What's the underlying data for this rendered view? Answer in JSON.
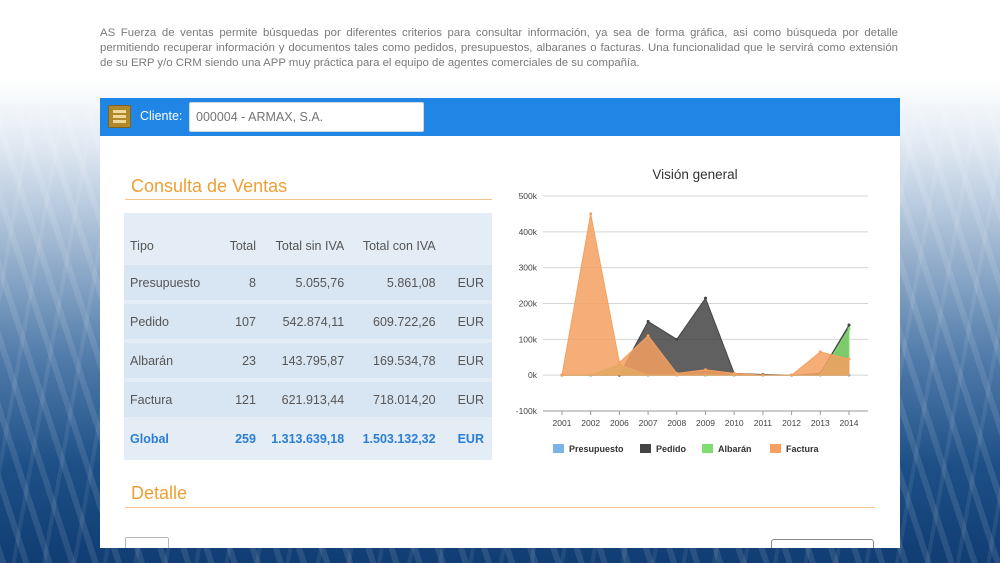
{
  "intro": {
    "text": "AS Fuerza de ventas permite búsquedas por diferentes criterios para consultar información, ya sea de forma gráfica, asi como búsqueda por  detalle permitiendo recuperar información y documentos tales como pedidos, presupuestos, albaranes o facturas. Una funcionalidad que le servirá como extensión de su ERP y/o CRM siendo una APP muy práctica para el equipo de agentes comerciales de su compañía."
  },
  "topbar": {
    "client_label": "Cliente:",
    "client_placeholder": "000004 - ARMAX, S.A."
  },
  "consulta": {
    "title": "Consulta de Ventas",
    "headers": [
      "Tipo",
      "Total",
      "Total sin IVA",
      "Total con IVA",
      ""
    ],
    "rows": [
      {
        "tipo": "Presupuesto",
        "total": "8",
        "sin_iva": "5.055,76",
        "con_iva": "5.861,08",
        "currency": "EUR"
      },
      {
        "tipo": "Pedido",
        "total": "107",
        "sin_iva": "542.874,11",
        "con_iva": "609.722,26",
        "currency": "EUR"
      },
      {
        "tipo": "Albarán",
        "total": "23",
        "sin_iva": "143.795,87",
        "con_iva": "169.534,78",
        "currency": "EUR"
      },
      {
        "tipo": "Factura",
        "total": "121",
        "sin_iva": "621.913,44",
        "con_iva": "718.014,20",
        "currency": "EUR"
      }
    ],
    "global": {
      "tipo": "Global",
      "total": "259",
      "sin_iva": "1.313.639,18",
      "con_iva": "1.503.132,32",
      "currency": "EUR"
    }
  },
  "detalle": {
    "title": "Detalle"
  },
  "colors": {
    "accent_orange": "#f0a033",
    "topbar_blue": "#1f86e6",
    "global_blue": "#2a7ed4"
  },
  "chart_data": {
    "type": "area",
    "title": "Visión general",
    "x": [
      "2001",
      "2002",
      "2006",
      "2007",
      "2008",
      "2009",
      "2010",
      "2011",
      "2012",
      "2013",
      "2014"
    ],
    "ylim": [
      -100000,
      500000
    ],
    "yticks": [
      -100000,
      0,
      100000,
      200000,
      300000,
      400000,
      500000
    ],
    "ytick_labels": [
      "-100k",
      "0k",
      "100k",
      "200k",
      "300k",
      "400k",
      "500k"
    ],
    "grid": true,
    "legend_position": "bottom",
    "series": [
      {
        "name": "Presupuesto",
        "color": "#7ab3e6",
        "values": [
          0,
          0,
          0,
          0,
          0,
          0,
          0,
          0,
          0,
          0,
          0
        ]
      },
      {
        "name": "Pedido",
        "color": "#444444",
        "values": [
          0,
          0,
          0,
          150000,
          100000,
          215000,
          5000,
          2000,
          0,
          5000,
          140000
        ]
      },
      {
        "name": "Albarán",
        "color": "#80dd70",
        "values": [
          0,
          0,
          30000,
          0,
          0,
          0,
          0,
          0,
          0,
          0,
          130000
        ]
      },
      {
        "name": "Factura",
        "color": "#f5a060",
        "values": [
          0,
          450000,
          35000,
          110000,
          5000,
          15000,
          5000,
          0,
          0,
          65000,
          45000
        ]
      }
    ]
  }
}
